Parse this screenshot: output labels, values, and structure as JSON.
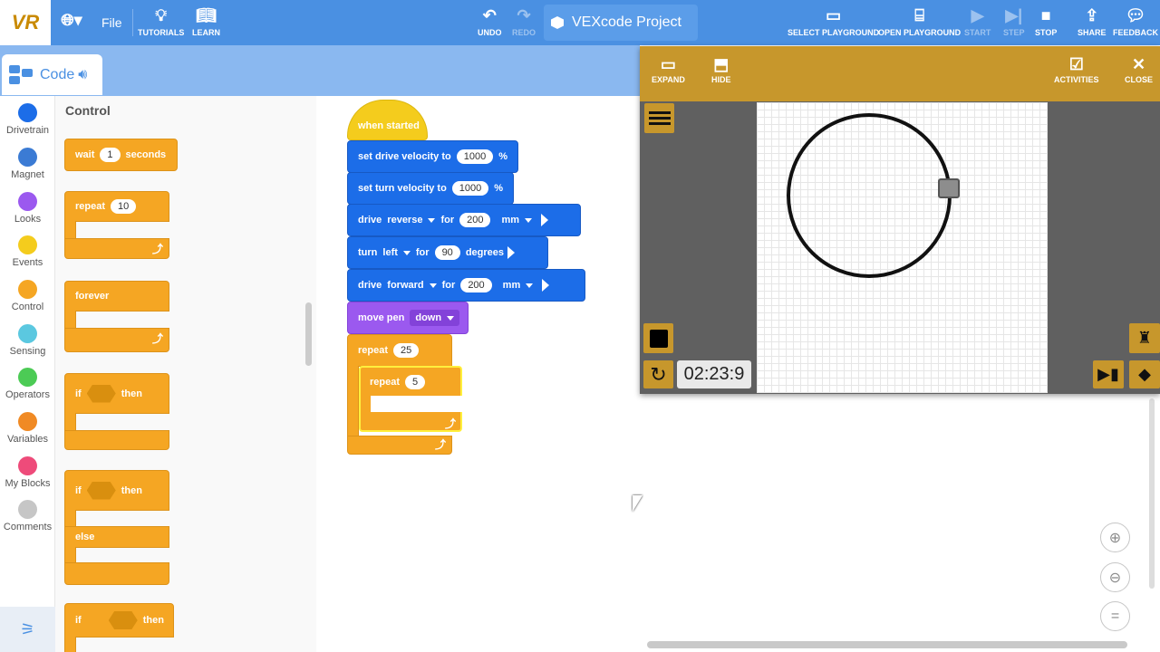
{
  "topbar": {
    "logo": "VR",
    "file": "File",
    "tutorials": "TUTORIALS",
    "learn": "LEARN",
    "undo": "UNDO",
    "redo": "REDO",
    "project_name": "VEXcode Project",
    "select_playground": "SELECT PLAYGROUND",
    "open_playground": "OPEN PLAYGROUND",
    "start": "START",
    "step": "STEP",
    "stop": "STOP",
    "share": "SHARE",
    "feedback": "FEEDBACK"
  },
  "code_tab": {
    "label": "Code"
  },
  "categories": [
    {
      "label": "Drivetrain",
      "color": "#1c6de8"
    },
    {
      "label": "Magnet",
      "color": "#3b7bd4"
    },
    {
      "label": "Looks",
      "color": "#9b59ef"
    },
    {
      "label": "Events",
      "color": "#f4cc1d"
    },
    {
      "label": "Control",
      "color": "#f5a623"
    },
    {
      "label": "Sensing",
      "color": "#5bc8e0"
    },
    {
      "label": "Operators",
      "color": "#4ccb55"
    },
    {
      "label": "Variables",
      "color": "#f08a24"
    },
    {
      "label": "My Blocks",
      "color": "#ee4b7a"
    },
    {
      "label": "Comments",
      "color": "#c6c6c6"
    }
  ],
  "palette": {
    "title": "Control",
    "wait": {
      "kw": "wait",
      "value": "1",
      "unit": "seconds"
    },
    "repeat": {
      "kw": "repeat",
      "value": "10"
    },
    "forever": {
      "kw": "forever"
    },
    "if_then": {
      "if": "if",
      "then": "then"
    },
    "if_else": {
      "if": "if",
      "then": "then",
      "else": "else"
    },
    "if_then_2": {
      "if": "if",
      "then": "then"
    }
  },
  "script": {
    "when_started": "when started",
    "drive_vel": {
      "text": "set drive velocity to",
      "value": "1000",
      "unit": "%"
    },
    "turn_vel": {
      "text": "set turn velocity to",
      "value": "1000",
      "unit": "%"
    },
    "drive1": {
      "kw": "drive",
      "dir": "reverse",
      "for": "for",
      "value": "200",
      "unit": "mm"
    },
    "turn": {
      "kw": "turn",
      "dir": "left",
      "for": "for",
      "value": "90",
      "unit": "degrees"
    },
    "drive2": {
      "kw": "drive",
      "dir": "forward",
      "for": "for",
      "value": "200",
      "unit": "mm"
    },
    "pen": {
      "text": "move pen",
      "value": "down"
    },
    "repeat_outer": {
      "kw": "repeat",
      "value": "25"
    },
    "repeat_inner": {
      "kw": "repeat",
      "value": "5"
    }
  },
  "playground": {
    "expand": "EXPAND",
    "hide": "HIDE",
    "activities": "ACTIVITIES",
    "close": "CLOSE",
    "timer": "02:23:9"
  }
}
